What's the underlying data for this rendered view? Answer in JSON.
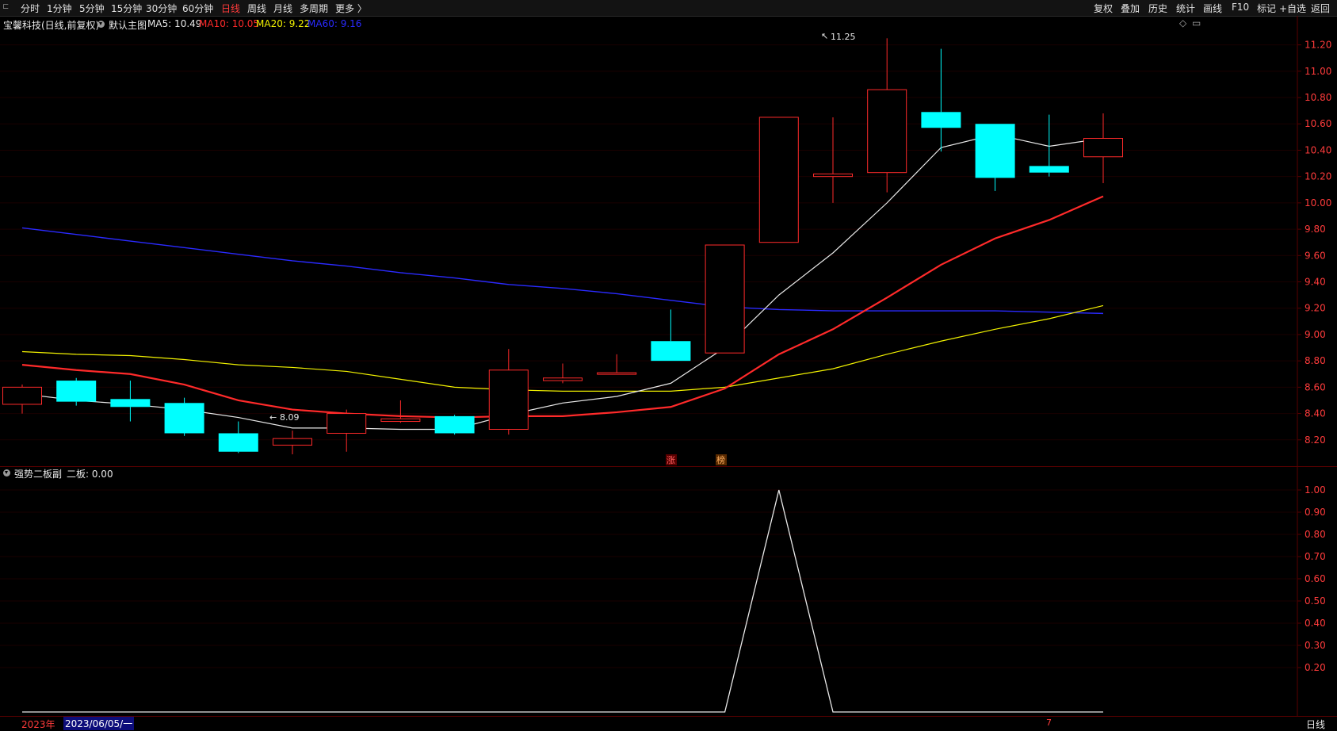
{
  "top_tabs": [
    {
      "label": "分时",
      "active": false
    },
    {
      "label": "1分钟",
      "active": false
    },
    {
      "label": "5分钟",
      "active": false
    },
    {
      "label": "15分钟",
      "active": false
    },
    {
      "label": "30分钟",
      "active": false
    },
    {
      "label": "60分钟",
      "active": false
    },
    {
      "label": "日线",
      "active": true
    },
    {
      "label": "周线",
      "active": false
    },
    {
      "label": "月线",
      "active": false
    },
    {
      "label": "多周期",
      "active": false
    },
    {
      "label": "更多 〉",
      "active": false
    }
  ],
  "right_tools": [
    "复权",
    "叠加",
    "历史",
    "统计",
    "画线",
    "F10",
    "标记",
    "+自选",
    "返回"
  ],
  "stock_title": "宝馨科技(日线,前复权)",
  "main_chart_name": "默认主图",
  "ma_legend": [
    {
      "label": "MA5: 10.49",
      "color": "#e8e8e8"
    },
    {
      "label": "MA10: 10.05",
      "color": "#ff2a2a"
    },
    {
      "label": "MA20: 9.22",
      "color": "#f2f200"
    },
    {
      "label": "MA60: 9.16",
      "color": "#2a2aff"
    }
  ],
  "sub_indicator_name": "强势二板副",
  "sub_indicator_value": "二板: 0.00",
  "price_axis_labels": [
    "11.20",
    "11.00",
    "10.80",
    "10.60",
    "10.40",
    "10.20",
    "10.00",
    "9.80",
    "9.60",
    "9.40",
    "9.20",
    "9.00",
    "8.80",
    "8.60",
    "8.40",
    "8.20"
  ],
  "sub_axis_labels": [
    "1.00",
    "0.90",
    "0.80",
    "0.70",
    "0.60",
    "0.50",
    "0.40",
    "0.30",
    "0.20"
  ],
  "high_annotation": "11.25",
  "low_annotation": "8.09",
  "event_markers": [
    "涨",
    "榜"
  ],
  "bottom_year": "2023年",
  "bottom_date": "2023/06/05/一",
  "bottom_mark": "7",
  "period_label": "日线",
  "colors": {
    "up": "#ff2a2a",
    "down": "#00ffff",
    "ma5": "#e8e8e8",
    "ma10": "#ff2a2a",
    "ma20": "#f2f200",
    "ma60": "#2a2aff",
    "grid": "#5a0000"
  },
  "chart_data": {
    "type": "candlestick",
    "price_range": [
      8.0,
      11.3
    ],
    "candles": [
      {
        "open": 8.47,
        "close": 8.6,
        "high": 8.62,
        "low": 8.4
      },
      {
        "open": 8.65,
        "close": 8.49,
        "high": 8.67,
        "low": 8.46
      },
      {
        "open": 8.51,
        "close": 8.45,
        "high": 8.65,
        "low": 8.34
      },
      {
        "open": 8.48,
        "close": 8.25,
        "high": 8.52,
        "low": 8.23
      },
      {
        "open": 8.25,
        "close": 8.11,
        "high": 8.34,
        "low": 8.1
      },
      {
        "open": 8.16,
        "close": 8.21,
        "high": 8.27,
        "low": 8.09
      },
      {
        "open": 8.25,
        "close": 8.4,
        "high": 8.43,
        "low": 8.11
      },
      {
        "open": 8.34,
        "close": 8.36,
        "high": 8.5,
        "low": 8.33
      },
      {
        "open": 8.38,
        "close": 8.25,
        "high": 8.39,
        "low": 8.24
      },
      {
        "open": 8.28,
        "close": 8.73,
        "high": 8.89,
        "low": 8.24
      },
      {
        "open": 8.65,
        "close": 8.67,
        "high": 8.78,
        "low": 8.63
      },
      {
        "open": 8.7,
        "close": 8.71,
        "high": 8.85,
        "low": 8.7
      },
      {
        "open": 8.95,
        "close": 8.8,
        "high": 9.19,
        "low": 8.8
      },
      {
        "open": 8.86,
        "close": 9.68,
        "high": 9.68,
        "low": 8.86
      },
      {
        "open": 9.7,
        "close": 10.65,
        "high": 10.65,
        "low": 9.7
      },
      {
        "open": 10.2,
        "close": 10.22,
        "high": 10.65,
        "low": 10.0
      },
      {
        "open": 10.23,
        "close": 10.86,
        "high": 11.25,
        "low": 10.08
      },
      {
        "open": 10.69,
        "close": 10.57,
        "high": 11.17,
        "low": 10.39
      },
      {
        "open": 10.6,
        "close": 10.19,
        "high": 10.6,
        "low": 10.09
      },
      {
        "open": 10.28,
        "close": 10.23,
        "high": 10.67,
        "low": 10.2
      },
      {
        "open": 10.35,
        "close": 10.49,
        "high": 10.68,
        "low": 10.15
      }
    ],
    "ma5": [
      8.55,
      8.5,
      8.47,
      8.43,
      8.37,
      8.29,
      8.29,
      8.28,
      8.28,
      8.39,
      8.48,
      8.53,
      8.63,
      8.9,
      9.3,
      9.62,
      10.0,
      10.42,
      10.52,
      10.43,
      10.49
    ],
    "ma10": [
      8.77,
      8.73,
      8.7,
      8.62,
      8.5,
      8.43,
      8.4,
      8.38,
      8.37,
      8.38,
      8.38,
      8.41,
      8.45,
      8.59,
      8.85,
      9.04,
      9.28,
      9.53,
      9.73,
      9.87,
      10.05
    ],
    "ma20": [
      8.87,
      8.85,
      8.84,
      8.81,
      8.77,
      8.75,
      8.72,
      8.66,
      8.6,
      8.58,
      8.57,
      8.57,
      8.57,
      8.6,
      8.67,
      8.74,
      8.85,
      8.95,
      9.04,
      9.12,
      9.22
    ],
    "ma60": [
      9.81,
      9.76,
      9.71,
      9.66,
      9.61,
      9.56,
      9.52,
      9.47,
      9.43,
      9.38,
      9.35,
      9.31,
      9.26,
      9.21,
      9.19,
      9.18,
      9.18,
      9.18,
      9.18,
      9.17,
      9.16
    ],
    "sub_series": [
      0,
      0,
      0,
      0,
      0,
      0,
      0,
      0,
      0,
      0,
      0,
      0,
      0,
      0,
      1,
      0,
      0,
      0,
      0,
      0,
      0
    ],
    "sub_range": [
      0,
      1.05
    ]
  }
}
